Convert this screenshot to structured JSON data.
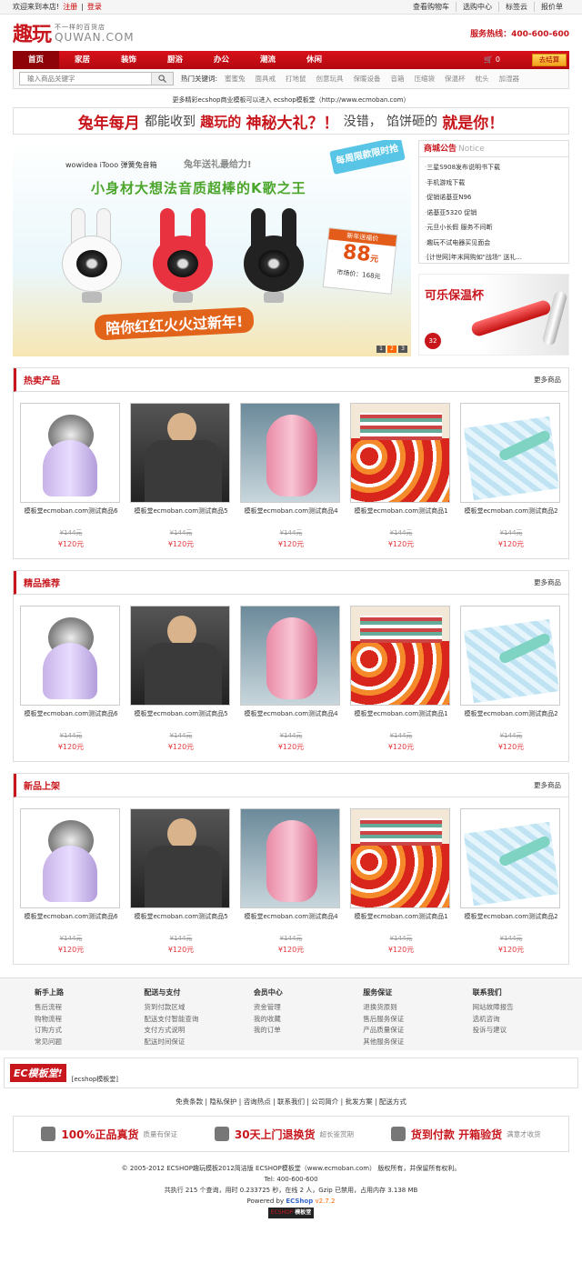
{
  "topbar": {
    "welcome": "欢迎来到本店!",
    "register": "注册",
    "login": "登录",
    "links": [
      "查看购物车",
      "选购中心",
      "标签云",
      "报价单"
    ]
  },
  "header": {
    "logo_cn": "趣玩",
    "logo_slogan": "不一样的百货店",
    "logo_en": "QUWAN.COM",
    "hotline": "服务热线：400-600-600"
  },
  "nav": {
    "items": [
      "首页",
      "家居",
      "装饰",
      "厨浴",
      "办公",
      "潮流",
      "休闲"
    ],
    "active": 0,
    "cart_count": "0",
    "checkout": "去结算"
  },
  "search": {
    "placeholder": "输入商品关键字",
    "hot_label": "热门关键词:",
    "keywords": [
      "蜜蜜兔",
      "面具戒",
      "打地鼠",
      "创意玩具",
      "保暖设备",
      "音箱",
      "压缩袋",
      "保温杯",
      "枕头",
      "加湿器"
    ]
  },
  "notice_text": "更多精彩ecshop商业模板可以进入 ecshop模板堂（http://www.ecmoban.com）",
  "banner": {
    "part1": "兔年每月",
    "part2": "都能收到",
    "part3": "趣玩的",
    "part4": "神秘大礼？！",
    "part5": "没错，",
    "part6": "馅饼砸的",
    "part7": "就是你！"
  },
  "slide": {
    "tag": "每周限款限时抢",
    "brand": "wowidea iTooo 弹簧兔音箱",
    "brand2": "兔年送礼最给力!",
    "headline": "小身材大想法音质超棒的K歌之王",
    "price_title": "新年送福价",
    "price": "88",
    "price_unit": "元",
    "market": "市场价：168元",
    "footer": "陪你红红火火过新年!",
    "dots": [
      "1",
      "2",
      "3"
    ],
    "active_dot": 1
  },
  "announce": {
    "title": "商城公告",
    "title_en": "Notice",
    "items": [
      "三星S908发布说明书下载",
      "手机游戏下载",
      "促销诺基亚N96",
      "诺基亚5320 促销",
      "元旦小长假 服务不间断",
      "趣玩不试电器买见面会",
      "[计世网]年末网购如\"战场\" 送礼..."
    ]
  },
  "cup_ad": {
    "title": "可乐保温杯",
    "badge": "32"
  },
  "sections": [
    {
      "title": "热卖产品",
      "more": "更多商品",
      "items": [
        {
          "name": "模板堂ecmoban.com测试商品6",
          "old": "¥144元",
          "price": "¥120元",
          "img": "shaver"
        },
        {
          "name": "模板堂ecmoban.com测试商品5",
          "old": "¥144元",
          "price": "¥120元",
          "img": "shawl"
        },
        {
          "name": "模板堂ecmoban.com测试商品4",
          "old": "¥144元",
          "price": "¥120元",
          "img": "pink"
        },
        {
          "name": "模板堂ecmoban.com测试商品1",
          "old": "¥144元",
          "price": "¥120元",
          "img": "bed"
        },
        {
          "name": "模板堂ecmoban.com测试商品2",
          "old": "¥144元",
          "price": "¥120元",
          "img": "bag"
        }
      ]
    },
    {
      "title": "精品推荐",
      "more": "更多商品",
      "items": [
        {
          "name": "模板堂ecmoban.com测试商品6",
          "old": "¥144元",
          "price": "¥120元",
          "img": "shaver"
        },
        {
          "name": "模板堂ecmoban.com测试商品5",
          "old": "¥144元",
          "price": "¥120元",
          "img": "shawl"
        },
        {
          "name": "模板堂ecmoban.com测试商品4",
          "old": "¥144元",
          "price": "¥120元",
          "img": "pink"
        },
        {
          "name": "模板堂ecmoban.com测试商品1",
          "old": "¥144元",
          "price": "¥120元",
          "img": "bed"
        },
        {
          "name": "模板堂ecmoban.com测试商品2",
          "old": "¥144元",
          "price": "¥120元",
          "img": "bag"
        }
      ]
    },
    {
      "title": "新品上架",
      "more": "更多商品",
      "items": [
        {
          "name": "模板堂ecmoban.com测试商品6",
          "old": "¥144元",
          "price": "¥120元",
          "img": "shaver"
        },
        {
          "name": "模板堂ecmoban.com测试商品5",
          "old": "¥144元",
          "price": "¥120元",
          "img": "shawl"
        },
        {
          "name": "模板堂ecmoban.com测试商品4",
          "old": "¥144元",
          "price": "¥120元",
          "img": "pink"
        },
        {
          "name": "模板堂ecmoban.com测试商品1",
          "old": "¥144元",
          "price": "¥120元",
          "img": "bed"
        },
        {
          "name": "模板堂ecmoban.com测试商品2",
          "old": "¥144元",
          "price": "¥120元",
          "img": "bag"
        }
      ]
    }
  ],
  "footer_nav": [
    {
      "title": "新手上路",
      "links": [
        "售后流程",
        "购物流程",
        "订购方式",
        "常见问题"
      ]
    },
    {
      "title": "配送与支付",
      "links": [
        "货到付款区域",
        "配送支付智能查询",
        "支付方式说明",
        "配送时间保证"
      ]
    },
    {
      "title": "会员中心",
      "links": [
        "资金管理",
        "我的收藏",
        "我的订单"
      ]
    },
    {
      "title": "服务保证",
      "links": [
        "退换货原则",
        "售后服务保证",
        "产品质量保证",
        "其他服务保证"
      ]
    },
    {
      "title": "联系我们",
      "links": [
        "网站故障报告",
        "选机咨询",
        "投诉与建议"
      ]
    }
  ],
  "ec_ad": {
    "logo": "EC模板堂!",
    "text": "[ecshop模板堂]"
  },
  "bottom_links": [
    "免责条款",
    "隐私保护",
    "咨询热点",
    "联系我们",
    "公司简介",
    "批发方案",
    "配送方式"
  ],
  "guarantees": [
    {
      "bold": "100%正品真货",
      "small": "质量有保证"
    },
    {
      "bold": "30天上门退换货",
      "small": "超长鉴赏期"
    },
    {
      "bold": "货到付款 开箱验货",
      "small": "满意才收货"
    }
  ],
  "copyright": {
    "line1": "© 2005-2012 ECSHOP趣玩模板2012简洁版 ECSHOP模板堂（www.ecmoban.com） 版权所有，并保留所有权利。",
    "line2": "Tel: 400-600-600",
    "line3": "共执行 215 个查询，用时 0.233725 秒，在线 2 人，Gzip 已禁用，占用内存 3.138 MB",
    "powered": "Powered by",
    "ecshop": "ECShop",
    "version": "v2.7.2",
    "badge1": "ECSHOP",
    "badge2": "模板堂"
  }
}
